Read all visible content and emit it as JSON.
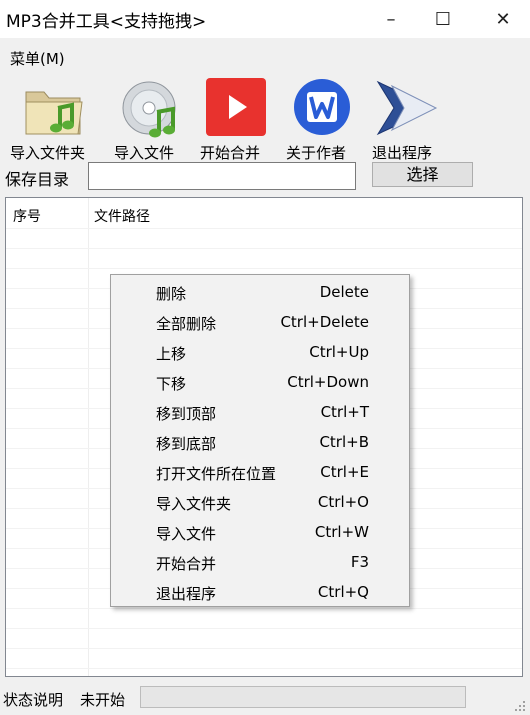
{
  "window": {
    "title": "MP3合并工具<支持拖拽>",
    "minimize_glyph": "–",
    "maximize_glyph": "☐",
    "close_glyph": "✕"
  },
  "menubar": {
    "menu_label": "菜单(M)"
  },
  "toolbar": {
    "buttons": [
      {
        "label": "导入文件夹",
        "icon": "folder-music-icon"
      },
      {
        "label": "导入文件",
        "icon": "cd-music-icon"
      },
      {
        "label": "开始合并",
        "icon": "play-icon"
      },
      {
        "label": "关于作者",
        "icon": "w-logo-icon"
      },
      {
        "label": "退出程序",
        "icon": "exit-arrow-icon"
      }
    ]
  },
  "save": {
    "label": "保存目录",
    "value": "",
    "choose_label": "选择"
  },
  "list": {
    "columns": [
      "序号",
      "文件路径"
    ]
  },
  "context_menu": {
    "items": [
      {
        "label": "删除",
        "shortcut": "Delete"
      },
      {
        "label": "全部删除",
        "shortcut": "Ctrl+Delete"
      },
      {
        "label": "上移",
        "shortcut": "Ctrl+Up"
      },
      {
        "label": "下移",
        "shortcut": "Ctrl+Down"
      },
      {
        "label": "移到顶部",
        "shortcut": "Ctrl+T"
      },
      {
        "label": "移到底部",
        "shortcut": "Ctrl+B"
      },
      {
        "label": "打开文件所在位置",
        "shortcut": "Ctrl+E"
      },
      {
        "label": "导入文件夹",
        "shortcut": "Ctrl+O"
      },
      {
        "label": "导入文件",
        "shortcut": "Ctrl+W"
      },
      {
        "label": "开始合并",
        "shortcut": "F3"
      },
      {
        "label": "退出程序",
        "shortcut": "Ctrl+Q"
      }
    ]
  },
  "status": {
    "label": "状态说明",
    "value": "未开始",
    "progress": 0
  },
  "colors": {
    "play_red": "#e8322e",
    "logo_blue": "#2a5dd6",
    "arrow_blue": "#2e4f96"
  }
}
